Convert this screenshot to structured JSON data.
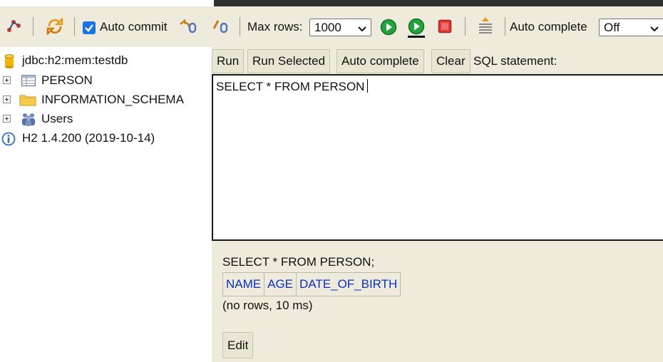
{
  "toolbar": {
    "auto_commit_label": "Auto commit",
    "auto_commit_checked": true,
    "max_rows_label": "Max rows:",
    "max_rows_value": "1000",
    "auto_complete_label": "Auto complete",
    "auto_complete_value": "Off",
    "accent_color": "#1a73e8"
  },
  "tree": {
    "connection": "jdbc:h2:mem:testdb",
    "items": [
      {
        "label": "PERSON",
        "icon": "table-icon"
      },
      {
        "label": "INFORMATION_SCHEMA",
        "icon": "folder-icon"
      },
      {
        "label": "Users",
        "icon": "users-icon"
      }
    ],
    "version": "H2 1.4.200 (2019-10-14)"
  },
  "query_bar": {
    "run": "Run",
    "run_selected": "Run Selected",
    "auto_complete": "Auto complete",
    "clear": "Clear",
    "sql_label": "SQL statement:"
  },
  "editor": {
    "text": "SELECT * FROM PERSON"
  },
  "result": {
    "query": "SELECT * FROM PERSON;",
    "columns": [
      "NAME",
      "AGE",
      "DATE_OF_BIRTH"
    ],
    "status": "(no rows, 10 ms)",
    "edit_label": "Edit"
  }
}
